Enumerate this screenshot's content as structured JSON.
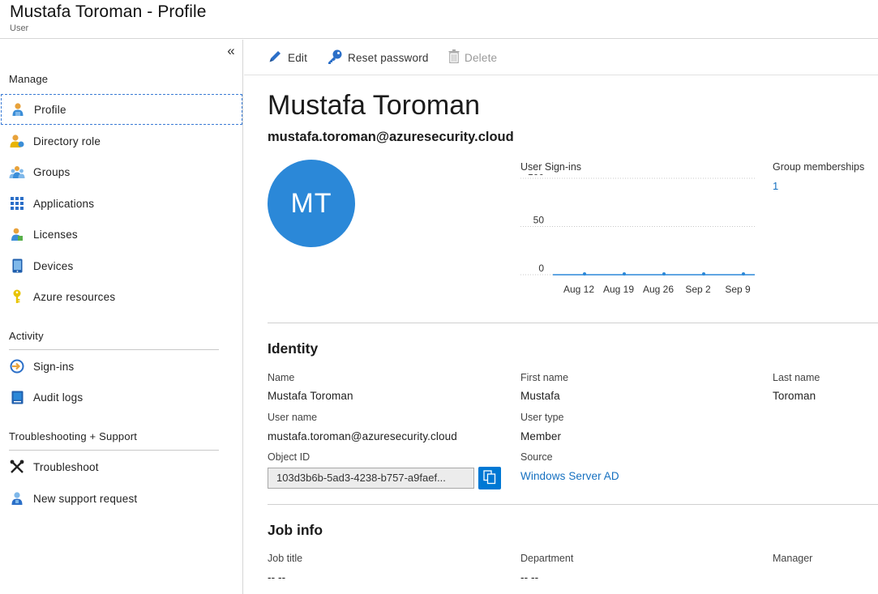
{
  "header": {
    "title": "Mustafa Toroman - Profile",
    "subtitle": "User"
  },
  "sidebar": {
    "collapse_glyph": "«",
    "sections": [
      {
        "header": "Manage"
      },
      {
        "header": "Activity"
      },
      {
        "header": "Troubleshooting + Support"
      }
    ],
    "manage_items": [
      {
        "label": "Profile",
        "icon": "user-icon",
        "active": true
      },
      {
        "label": "Directory role",
        "icon": "directory-role-icon"
      },
      {
        "label": "Groups",
        "icon": "groups-icon"
      },
      {
        "label": "Applications",
        "icon": "applications-grid-icon"
      },
      {
        "label": "Licenses",
        "icon": "licenses-icon"
      },
      {
        "label": "Devices",
        "icon": "device-icon"
      },
      {
        "label": "Azure resources",
        "icon": "key-icon"
      }
    ],
    "activity_items": [
      {
        "label": "Sign-ins",
        "icon": "sign-in-icon"
      },
      {
        "label": "Audit logs",
        "icon": "audit-log-icon"
      }
    ],
    "support_items": [
      {
        "label": "Troubleshoot",
        "icon": "wrench-icon"
      },
      {
        "label": "New support request",
        "icon": "support-user-icon"
      }
    ]
  },
  "toolbar": {
    "edit_label": "Edit",
    "reset_password_label": "Reset password",
    "delete_label": "Delete"
  },
  "profile": {
    "display_name": "Mustafa Toroman",
    "email": "mustafa.toroman@azuresecurity.cloud",
    "initials": "MT",
    "group_memberships_label": "Group memberships",
    "group_memberships_value": "1"
  },
  "chart_data": {
    "type": "line",
    "title": "User Sign-ins",
    "x": [
      "Aug 12",
      "Aug 19",
      "Aug 26",
      "Sep 2",
      "Sep 9"
    ],
    "series": [
      {
        "values": [
          0,
          0,
          0,
          0,
          0
        ]
      }
    ],
    "ylim": [
      0,
      100
    ],
    "yticks": [
      "100",
      "50",
      "0"
    ],
    "grid": true
  },
  "identity": {
    "title": "Identity",
    "name_label": "Name",
    "name_value": "Mustafa Toroman",
    "first_name_label": "First name",
    "first_name_value": "Mustafa",
    "last_name_label": "Last name",
    "last_name_value": "Toroman",
    "user_name_label": "User name",
    "user_name_value": "mustafa.toroman@azuresecurity.cloud",
    "user_type_label": "User type",
    "user_type_value": "Member",
    "object_id_label": "Object ID",
    "object_id_value": "103d3b6b-5ad3-4238-b757-a9faef...",
    "source_label": "Source",
    "source_value": "Windows Server AD"
  },
  "job_info": {
    "title": "Job info",
    "job_title_label": "Job title",
    "job_title_value": "-- --",
    "department_label": "Department",
    "department_value": "-- --",
    "manager_label": "Manager"
  },
  "colors": {
    "accent": "#0078d4",
    "avatar": "#2b88d8",
    "link": "#1570c0",
    "active_outline": "#3a7bd5"
  }
}
